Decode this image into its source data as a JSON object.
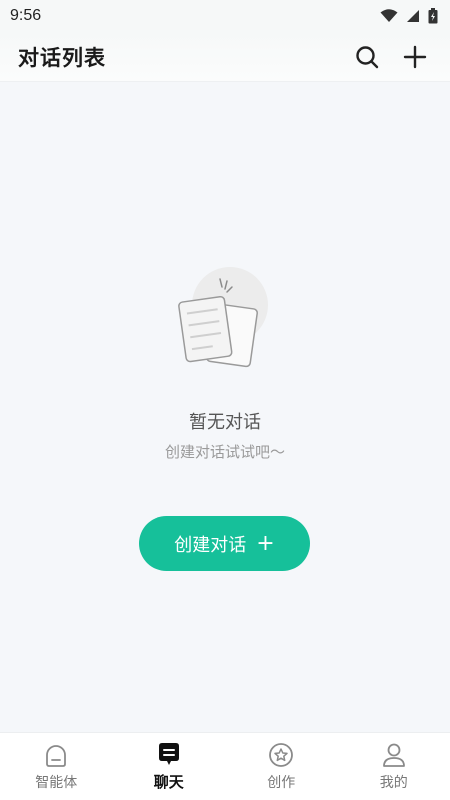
{
  "status_bar": {
    "time": "9:56"
  },
  "header": {
    "title": "对话列表"
  },
  "empty_state": {
    "title": "暂无对话",
    "subtitle": "创建对话试试吧～"
  },
  "create_button": {
    "label": "创建对话",
    "icon": "+"
  },
  "tabbar": {
    "tabs": [
      {
        "label": "智能体",
        "icon": "robot-face-icon",
        "active": false
      },
      {
        "label": "聊天",
        "icon": "chat-bubble-icon",
        "active": true
      },
      {
        "label": "创作",
        "icon": "star-badge-icon",
        "active": false
      },
      {
        "label": "我的",
        "icon": "person-icon",
        "active": false
      }
    ]
  },
  "colors": {
    "accent": "#16c09a",
    "background": "#f5f7fa"
  }
}
